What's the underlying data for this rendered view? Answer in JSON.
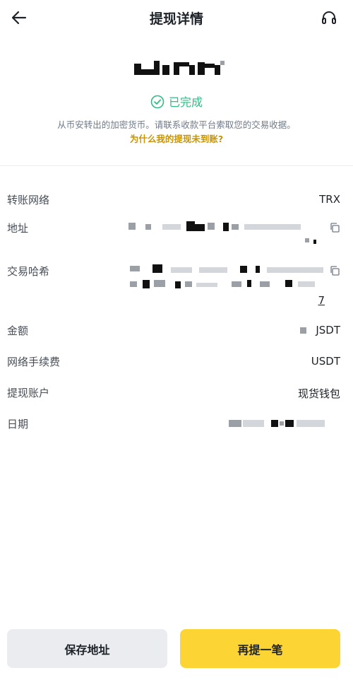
{
  "header": {
    "title": "提现详情",
    "back_icon": "arrow-left-icon",
    "support_icon": "headset-icon"
  },
  "summary": {
    "status": "已完成",
    "status_color": "#2ebd85",
    "description": "从币安转出的加密货币。请联系收款平台索取您的交易收据。",
    "why_link": "为什么我的提现未到账?",
    "link_color": "#c99400"
  },
  "details": [
    {
      "label": "转账网络",
      "value": "TRX"
    },
    {
      "label": "地址",
      "value": ""
    },
    {
      "label": "交易哈希",
      "value": "7"
    },
    {
      "label": "金额",
      "value": "JSDT"
    },
    {
      "label": "网络手续费",
      "value": "USDT"
    },
    {
      "label": "提现账户",
      "value": "现货钱包"
    },
    {
      "label": "日期",
      "value": ""
    }
  ],
  "buttons": {
    "save_address": "保存地址",
    "withdraw_again": "再提一笔",
    "primary_color": "#fcd535"
  }
}
